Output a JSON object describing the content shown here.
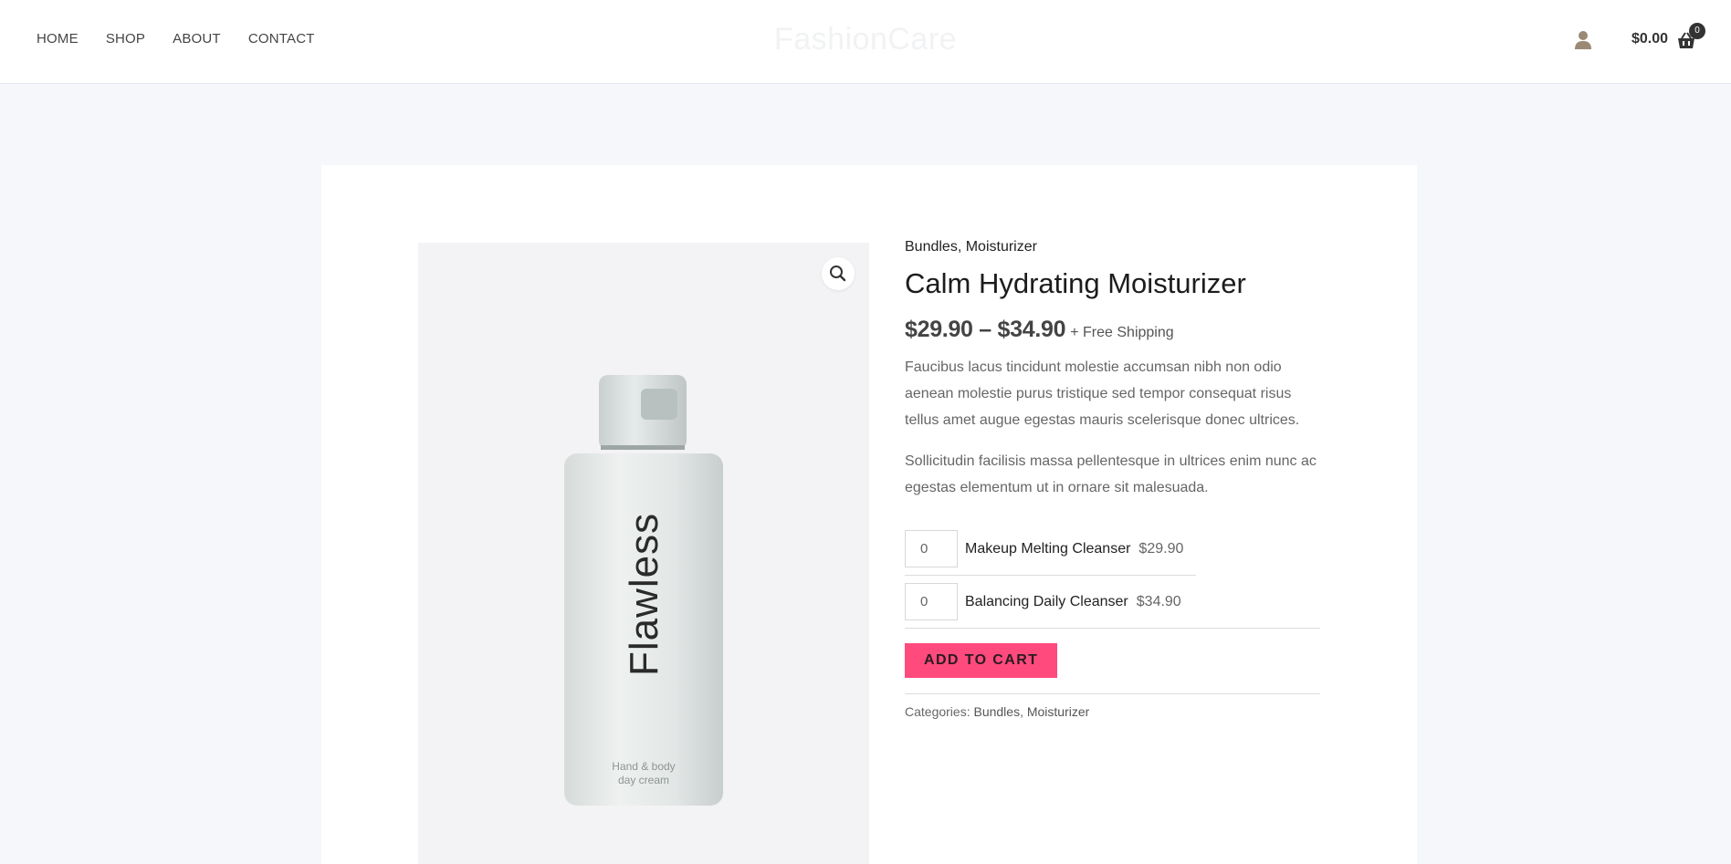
{
  "header": {
    "nav": [
      "HOME",
      "SHOP",
      "ABOUT",
      "CONTACT"
    ],
    "logo": "FashionCare",
    "cart_total": "$0.00",
    "cart_count": "0"
  },
  "product": {
    "category_1": "Bundles",
    "category_sep": ", ",
    "category_2": "Moisturizer",
    "title": "Calm Hydrating Moisturizer",
    "price_range": "$29.90 – $34.90",
    "shipping": "+ Free Shipping",
    "description_1": "Faucibus lacus tincidunt molestie accumsan nibh non odio aenean molestie purus tristique sed tempor consequat risus tellus amet augue egestas mauris scelerisque donec ultrices.",
    "description_2": "Sollicitudin facilisis massa pellentesque in ultrices enim nunc ac egestas elementum ut in ornare sit malesuada.",
    "bottle_brand": "Flawless",
    "bottle_line1": "Hand & body",
    "bottle_line2": "day cream"
  },
  "grouped": [
    {
      "qty": "0",
      "name": "Makeup Melting Cleanser",
      "price": "$29.90"
    },
    {
      "qty": "0",
      "name": "Balancing Daily Cleanser",
      "price": "$34.90"
    }
  ],
  "add_to_cart": "ADD TO CART",
  "meta": {
    "label": "Categories: ",
    "cat_1": "Bundles",
    "sep": ", ",
    "cat_2": "Moisturizer"
  },
  "icons": {
    "user": "user-icon",
    "cart": "shopping-basket-icon",
    "zoom": "magnifier-icon"
  },
  "colors": {
    "accent": "#ff4a7d",
    "page_bg": "#f6f7fb"
  }
}
